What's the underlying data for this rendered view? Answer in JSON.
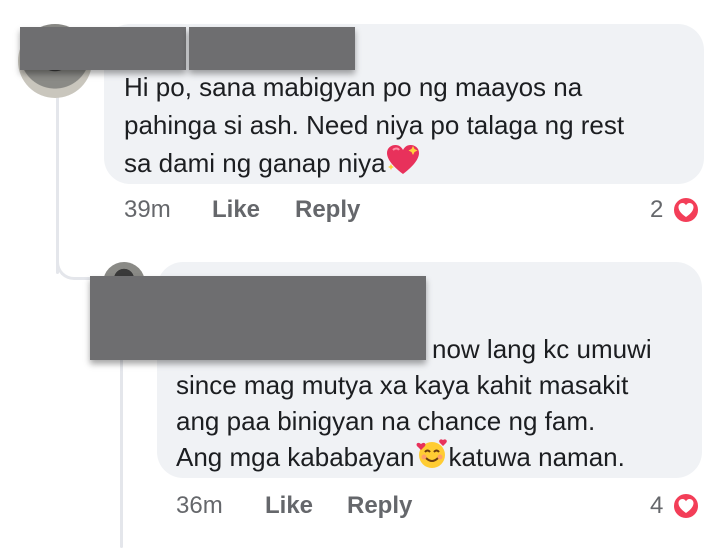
{
  "comments": [
    {
      "text_lines": [
        "Hi po, sana mabigyan po ng maayos na",
        "pahinga si ash. Need niya po talaga ng rest",
        "sa dami ng ganap niya"
      ],
      "emoji": "sparkling-heart-icon",
      "time": "39m",
      "like_label": "Like",
      "reply_label": "Reply",
      "reaction_count": "2"
    },
    {
      "text_lines": [
        "now lang kc umuwi",
        "since mag mutya xa kaya kahit masakit",
        "ang paa binigyan na chance ng fam.",
        "Ang mga kababayan",
        "katuwa naman."
      ],
      "emoji": "smiling-face-with-hearts-icon",
      "time": "36m",
      "like_label": "Like",
      "reply_label": "Reply",
      "reaction_count": "4"
    }
  ],
  "colors": {
    "bubble": "#f0f2f5",
    "meta": "#65676b",
    "heart": "#f33e58"
  }
}
